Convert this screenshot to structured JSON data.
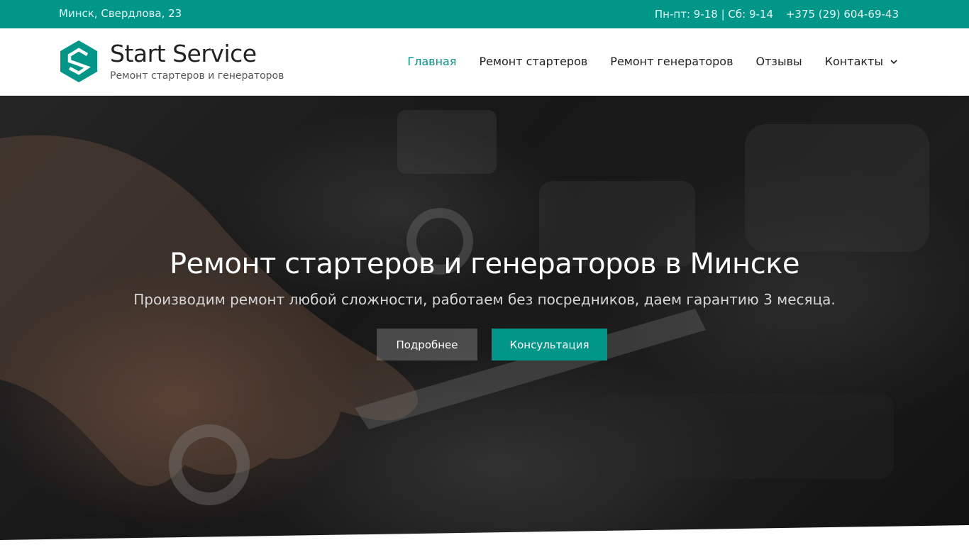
{
  "topbar": {
    "address": "Минск, Свердлова, 23",
    "hours": "Пн-пт: 9-18 | Сб: 9-14",
    "phone": "+375 (29) 604-69-43"
  },
  "brand": {
    "name": "Start Service",
    "tagline": "Ремонт стартеров и генераторов",
    "logo_icon": "s-hexagon-logo-icon"
  },
  "nav": {
    "items": [
      {
        "label": "Главная",
        "active": true
      },
      {
        "label": "Ремонт стартеров"
      },
      {
        "label": "Ремонт генераторов"
      },
      {
        "label": "Отзывы"
      },
      {
        "label": "Контакты",
        "has_dropdown": true,
        "icon": "chevron-down-icon"
      }
    ]
  },
  "hero": {
    "title": "Ремонт стартеров и генераторов в Минске",
    "subtitle": "Производим ремонт любой сложности, работаем без посредников, даем гарантию 3 месяца.",
    "more_button": "Подробнее",
    "consult_button": "Консультация"
  },
  "colors": {
    "accent": "#009688",
    "text_dark": "#222222"
  }
}
